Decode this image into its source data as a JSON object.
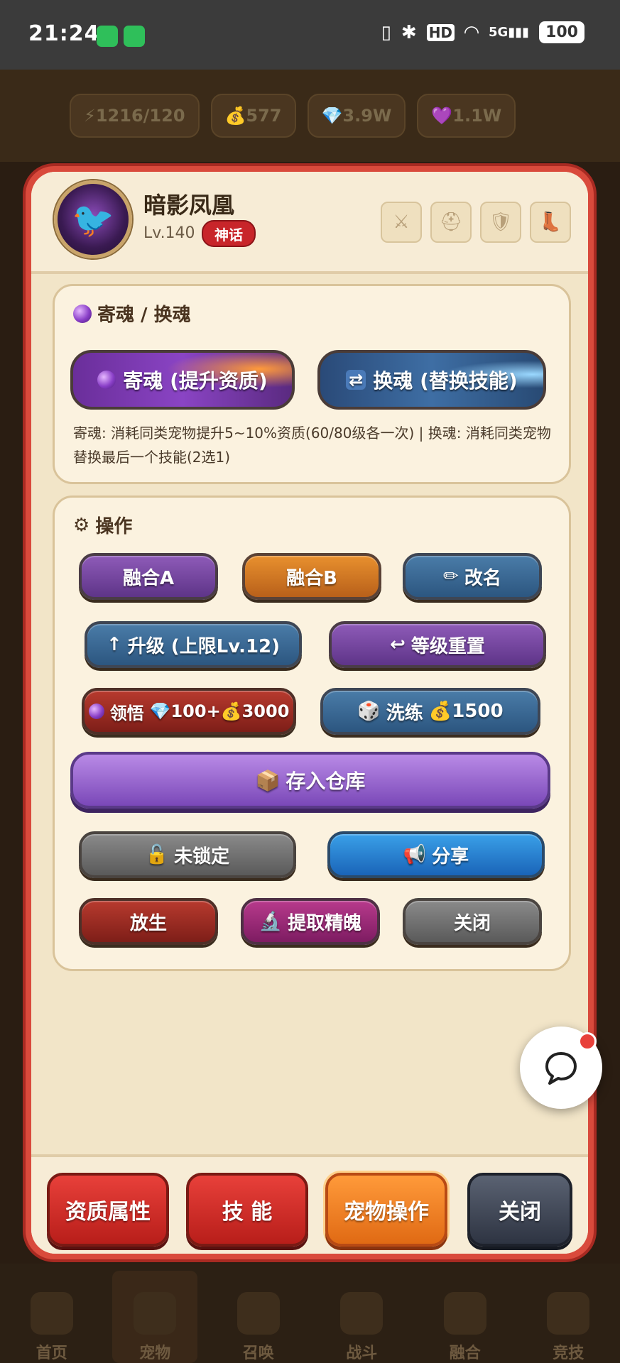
{
  "status_bar": {
    "time": "21:24",
    "hd": "HD",
    "signal": "5G",
    "battery": "100"
  },
  "background": {
    "resources": [
      "⚡1216/120",
      "💰577",
      "💎3.9W",
      "💜1.1W"
    ],
    "nav": [
      "首页",
      "宠物",
      "召唤",
      "战斗",
      "融合",
      "竞技"
    ]
  },
  "pet": {
    "name": "暗影凤凰",
    "level": "Lv.140",
    "rarity": "神话"
  },
  "equipment_icons": [
    "sword-icon",
    "helmet-icon",
    "shield-icon",
    "boot-icon"
  ],
  "soul_panel": {
    "title": "寄魂 / 换魂",
    "attach_button": "寄魂 (提升资质)",
    "swap_button": "换魂 (替换技能)",
    "description": "寄魂: 消耗同类宠物提升5~10%资质(60/80级各一次) | 换魂: 消耗同类宠物替换最后一个技能(2选1)"
  },
  "ops_panel": {
    "title": "操作",
    "fuse_a": "融合A",
    "fuse_b": "融合B",
    "rename": "改名",
    "upgrade": "升级 (上限Lv.12)",
    "reset_level": "等级重置",
    "comprehend": "领悟",
    "comprehend_gems": "100+",
    "comprehend_gold": "3000",
    "refine": "洗练",
    "refine_gold": "1500",
    "store": "存入仓库",
    "lock": "未锁定",
    "share": "分享",
    "release": "放生",
    "extract": "提取精魄",
    "close": "关闭"
  },
  "tabs": {
    "aptitude": "资质属性",
    "skills": "技 能",
    "pet_ops": "宠物操作",
    "close": "关闭"
  },
  "colors": {
    "accent_red": "#d94a3c",
    "panel_bg": "#fbf2df",
    "tab_active": "#ff9a3a"
  }
}
